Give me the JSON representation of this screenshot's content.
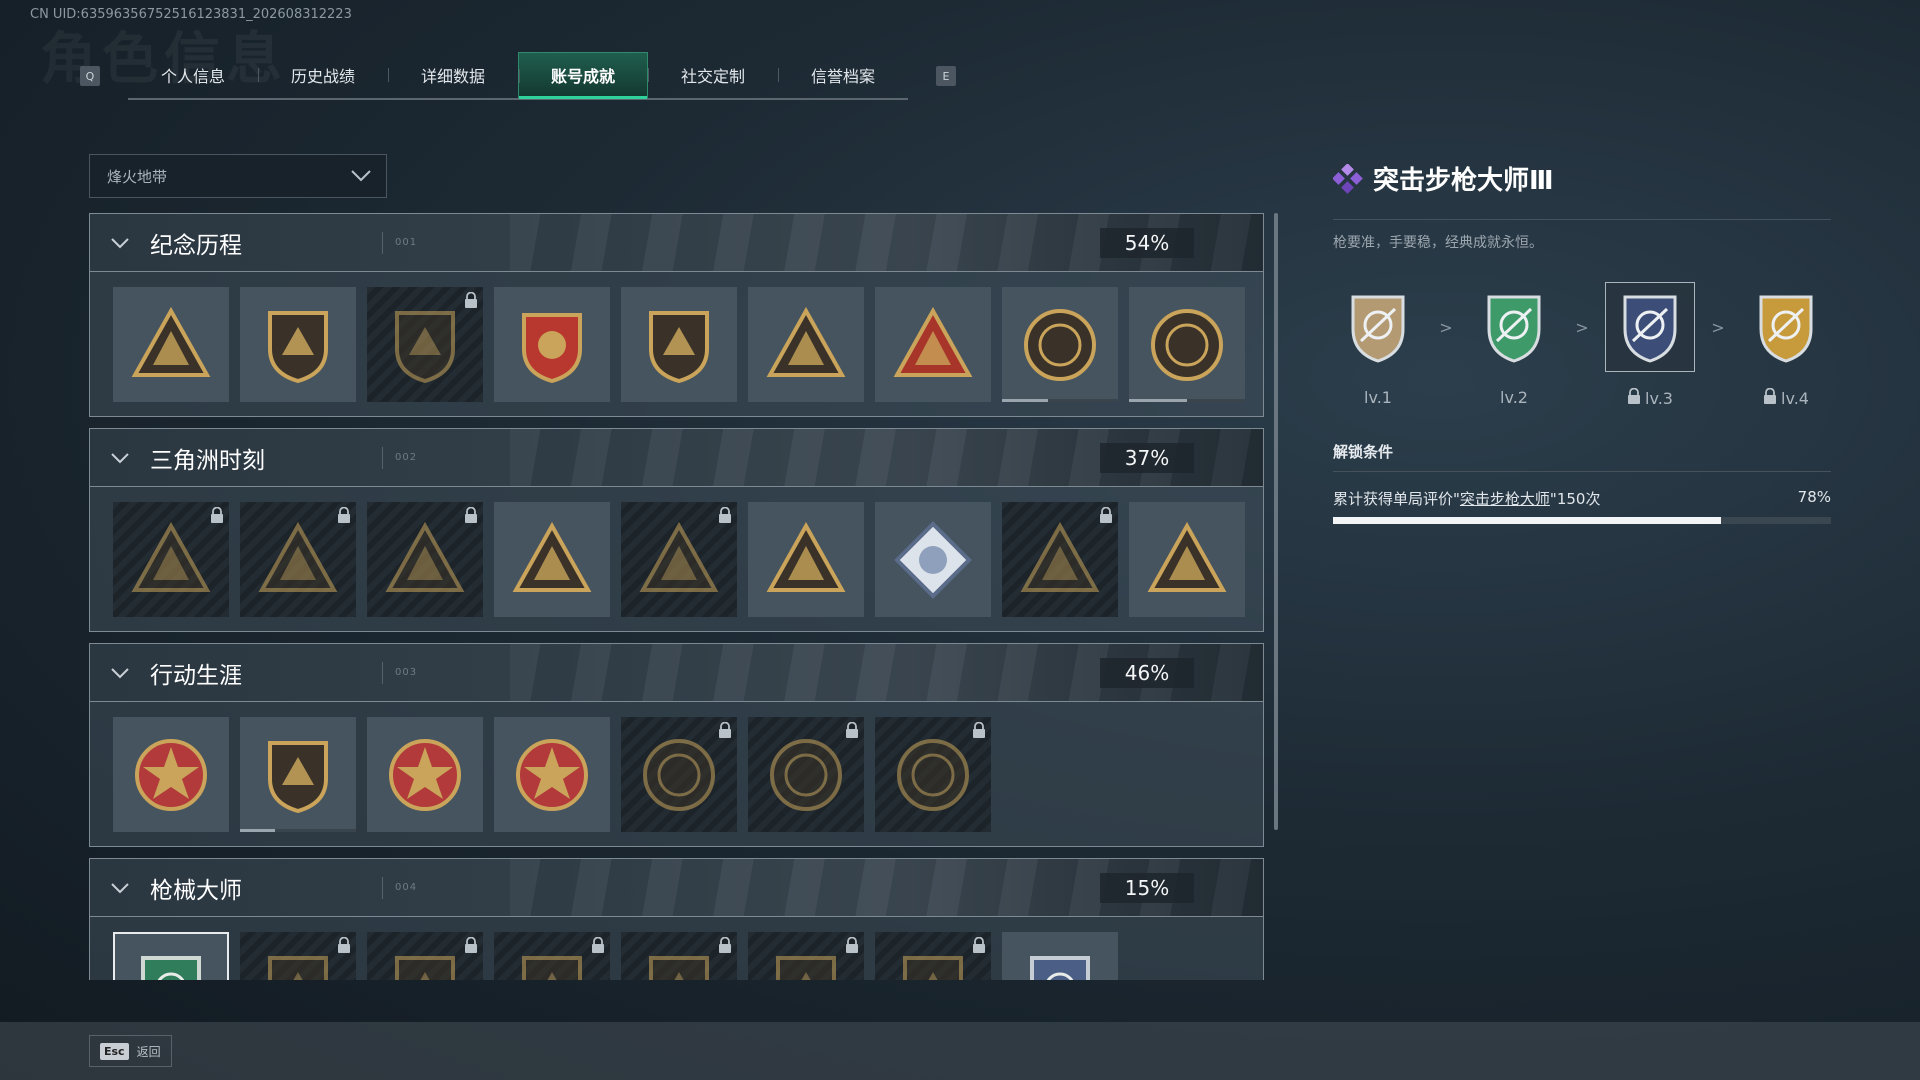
{
  "uid": "CN UID:6359635675251612383‌1_202608312223",
  "header": {
    "ghost_title": "角色信息",
    "key_left": "Q",
    "key_right": "E",
    "tabs": [
      {
        "label": "个人信息",
        "active": false
      },
      {
        "label": "历史战绩",
        "active": false
      },
      {
        "label": "详细数据",
        "active": false
      },
      {
        "label": "账号成就",
        "active": true
      },
      {
        "label": "社交定制",
        "active": false
      },
      {
        "label": "信誉档案",
        "active": false
      }
    ]
  },
  "mode_select": {
    "value": "烽火地带"
  },
  "categories": [
    {
      "title": "纪念历程",
      "number": "001",
      "percent": "54%",
      "badges": [
        {
          "icon": "triangle-emblem-icon",
          "locked": false,
          "progress": null
        },
        {
          "icon": "helicopter-emblem-icon",
          "locked": false,
          "progress": null
        },
        {
          "icon": "hex-shield-emblem-icon",
          "locked": true,
          "progress": null
        },
        {
          "icon": "s9-crest-emblem-icon",
          "locked": false,
          "progress": null
        },
        {
          "icon": "s10-eagle-emblem-icon",
          "locked": false,
          "progress": null
        },
        {
          "icon": "bird-triangle-emblem-icon",
          "locked": false,
          "progress": null
        },
        {
          "icon": "number-one-emblem-icon",
          "locked": false,
          "progress": null
        },
        {
          "icon": "delta-force-seal-icon",
          "locked": false,
          "progress": 0.4
        },
        {
          "icon": "delta-force-2026-seal-icon",
          "locked": false,
          "progress": 0.5
        }
      ]
    },
    {
      "title": "三角洲时刻",
      "number": "002",
      "percent": "37%",
      "badges": [
        {
          "icon": "robot-triangle-icon",
          "locked": true,
          "progress": null
        },
        {
          "icon": "runner-triangle-icon",
          "locked": true,
          "progress": null
        },
        {
          "icon": "grenade-triangle-icon",
          "locked": true,
          "progress": null
        },
        {
          "icon": "squad-triangle-icon",
          "locked": false,
          "progress": null
        },
        {
          "icon": "beast-triangle-icon",
          "locked": true,
          "progress": null
        },
        {
          "icon": "dragon-triangle-icon",
          "locked": false,
          "progress": null
        },
        {
          "icon": "rose-diamond-icon",
          "locked": false,
          "progress": null
        },
        {
          "icon": "serpent-triangle-icon",
          "locked": true,
          "progress": null
        },
        {
          "icon": "diver-triangle-icon",
          "locked": false,
          "progress": null
        }
      ]
    },
    {
      "title": "行动生涯",
      "number": "003",
      "percent": "46%",
      "badges": [
        {
          "icon": "star-medal-icon",
          "locked": false,
          "progress": null
        },
        {
          "icon": "shield-medal-icon",
          "locked": false,
          "progress": 0.3
        },
        {
          "icon": "three-star-crest-icon",
          "locked": false,
          "progress": null
        },
        {
          "icon": "four-star-crest-icon",
          "locked": false,
          "progress": null
        },
        {
          "icon": "helmet-coin-icon",
          "locked": true,
          "progress": null
        },
        {
          "icon": "skull-coin-icon",
          "locked": true,
          "progress": null
        },
        {
          "icon": "eye-coin-icon",
          "locked": true,
          "progress": null
        }
      ]
    },
    {
      "title": "枪械大师",
      "number": "004",
      "percent": "15%",
      "badges": [
        {
          "icon": "rifle-master-shield-icon",
          "locked": false,
          "selected": true,
          "progress": null
        },
        {
          "icon": "gun-shield-icon",
          "locked": true,
          "progress": null
        },
        {
          "icon": "gun-shield-icon",
          "locked": true,
          "progress": null
        },
        {
          "icon": "gun-shield-icon",
          "locked": true,
          "progress": null
        },
        {
          "icon": "gun-shield-icon",
          "locked": true,
          "progress": null
        },
        {
          "icon": "gun-shield-icon",
          "locked": true,
          "progress": null
        },
        {
          "icon": "gun-shield-icon",
          "locked": true,
          "progress": null
        },
        {
          "icon": "crosshair-shield-icon",
          "locked": false,
          "progress": null
        }
      ]
    }
  ],
  "detail": {
    "title": "突击步枪大师Ⅲ",
    "description": "枪要准，手要稳，经典成就永恒。",
    "levels": [
      {
        "label": "lv.1",
        "locked": false,
        "current": false,
        "color": "#b49a72"
      },
      {
        "label": "lv.2",
        "locked": false,
        "current": false,
        "color": "#3f9a6a"
      },
      {
        "label": "lv.3",
        "locked": true,
        "current": true,
        "color": "#3c4d78"
      },
      {
        "label": "lv.4",
        "locked": true,
        "current": false,
        "color": "#c79a3c"
      }
    ],
    "level_separator": ">",
    "unlock_title": "解锁条件",
    "condition_prefix": "累计获得单局评价\"",
    "condition_link": "突击步枪大师",
    "condition_suffix": "\"150次",
    "condition_percent": "78%",
    "condition_progress": 0.78
  },
  "footer": {
    "esc_key": "Esc",
    "back_label": "返回"
  },
  "colors": {
    "accent": "#2fd29b",
    "gold": "#c9a45a",
    "lock": "#b9c2c8"
  }
}
